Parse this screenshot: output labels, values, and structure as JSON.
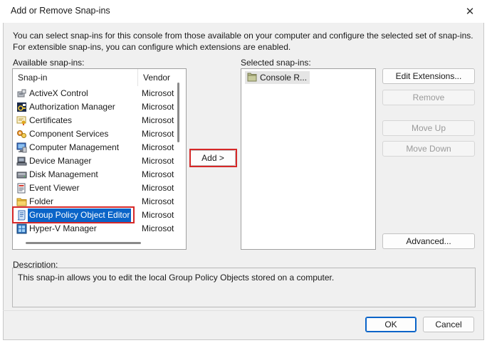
{
  "window": {
    "title": "Add or Remove Snap-ins",
    "close_glyph": "✕"
  },
  "intro": {
    "line1": "You can select snap-ins for this console from those available on your computer and configure the selected set of snap-ins.",
    "line2": "For extensible snap-ins, you can configure which extensions are enabled."
  },
  "available": {
    "label": "Available snap-ins:",
    "columns": {
      "snapin": "Snap-in",
      "vendor": "Vendor"
    },
    "items": [
      {
        "name": "ActiveX Control",
        "vendor": "Microsot",
        "icon": "activex-icon"
      },
      {
        "name": "Authorization Manager",
        "vendor": "Microsot",
        "icon": "authorization-icon"
      },
      {
        "name": "Certificates",
        "vendor": "Microsot",
        "icon": "certificate-icon"
      },
      {
        "name": "Component Services",
        "vendor": "Microsot",
        "icon": "component-services-icon"
      },
      {
        "name": "Computer Management",
        "vendor": "Microsot",
        "icon": "computer-management-icon"
      },
      {
        "name": "Device Manager",
        "vendor": "Microsot",
        "icon": "device-manager-icon"
      },
      {
        "name": "Disk Management",
        "vendor": "Microsot",
        "icon": "disk-management-icon"
      },
      {
        "name": "Event Viewer",
        "vendor": "Microsot",
        "icon": "event-viewer-icon"
      },
      {
        "name": "Folder",
        "vendor": "Microsot",
        "icon": "folder-icon"
      },
      {
        "name": "Group Policy Object Editor",
        "vendor": "Microsot",
        "icon": "group-policy-icon",
        "selected": true
      },
      {
        "name": "Hyper-V Manager",
        "vendor": "Microsot",
        "icon": "hyperv-icon"
      }
    ]
  },
  "add_button": "Add >",
  "selected": {
    "label": "Selected snap-ins:",
    "items": [
      {
        "name": "Console R...",
        "icon": "folder-icon"
      }
    ]
  },
  "side_buttons": {
    "edit_extensions": "Edit Extensions...",
    "remove": "Remove",
    "move_up": "Move Up",
    "move_down": "Move Down",
    "advanced": "Advanced..."
  },
  "description": {
    "label": "Description:",
    "text": "This snap-in allows you to edit the local Group Policy Objects stored on a computer."
  },
  "footer": {
    "ok": "OK",
    "cancel": "Cancel"
  },
  "colors": {
    "accent": "#0a64c8",
    "highlight": "#d62828"
  }
}
